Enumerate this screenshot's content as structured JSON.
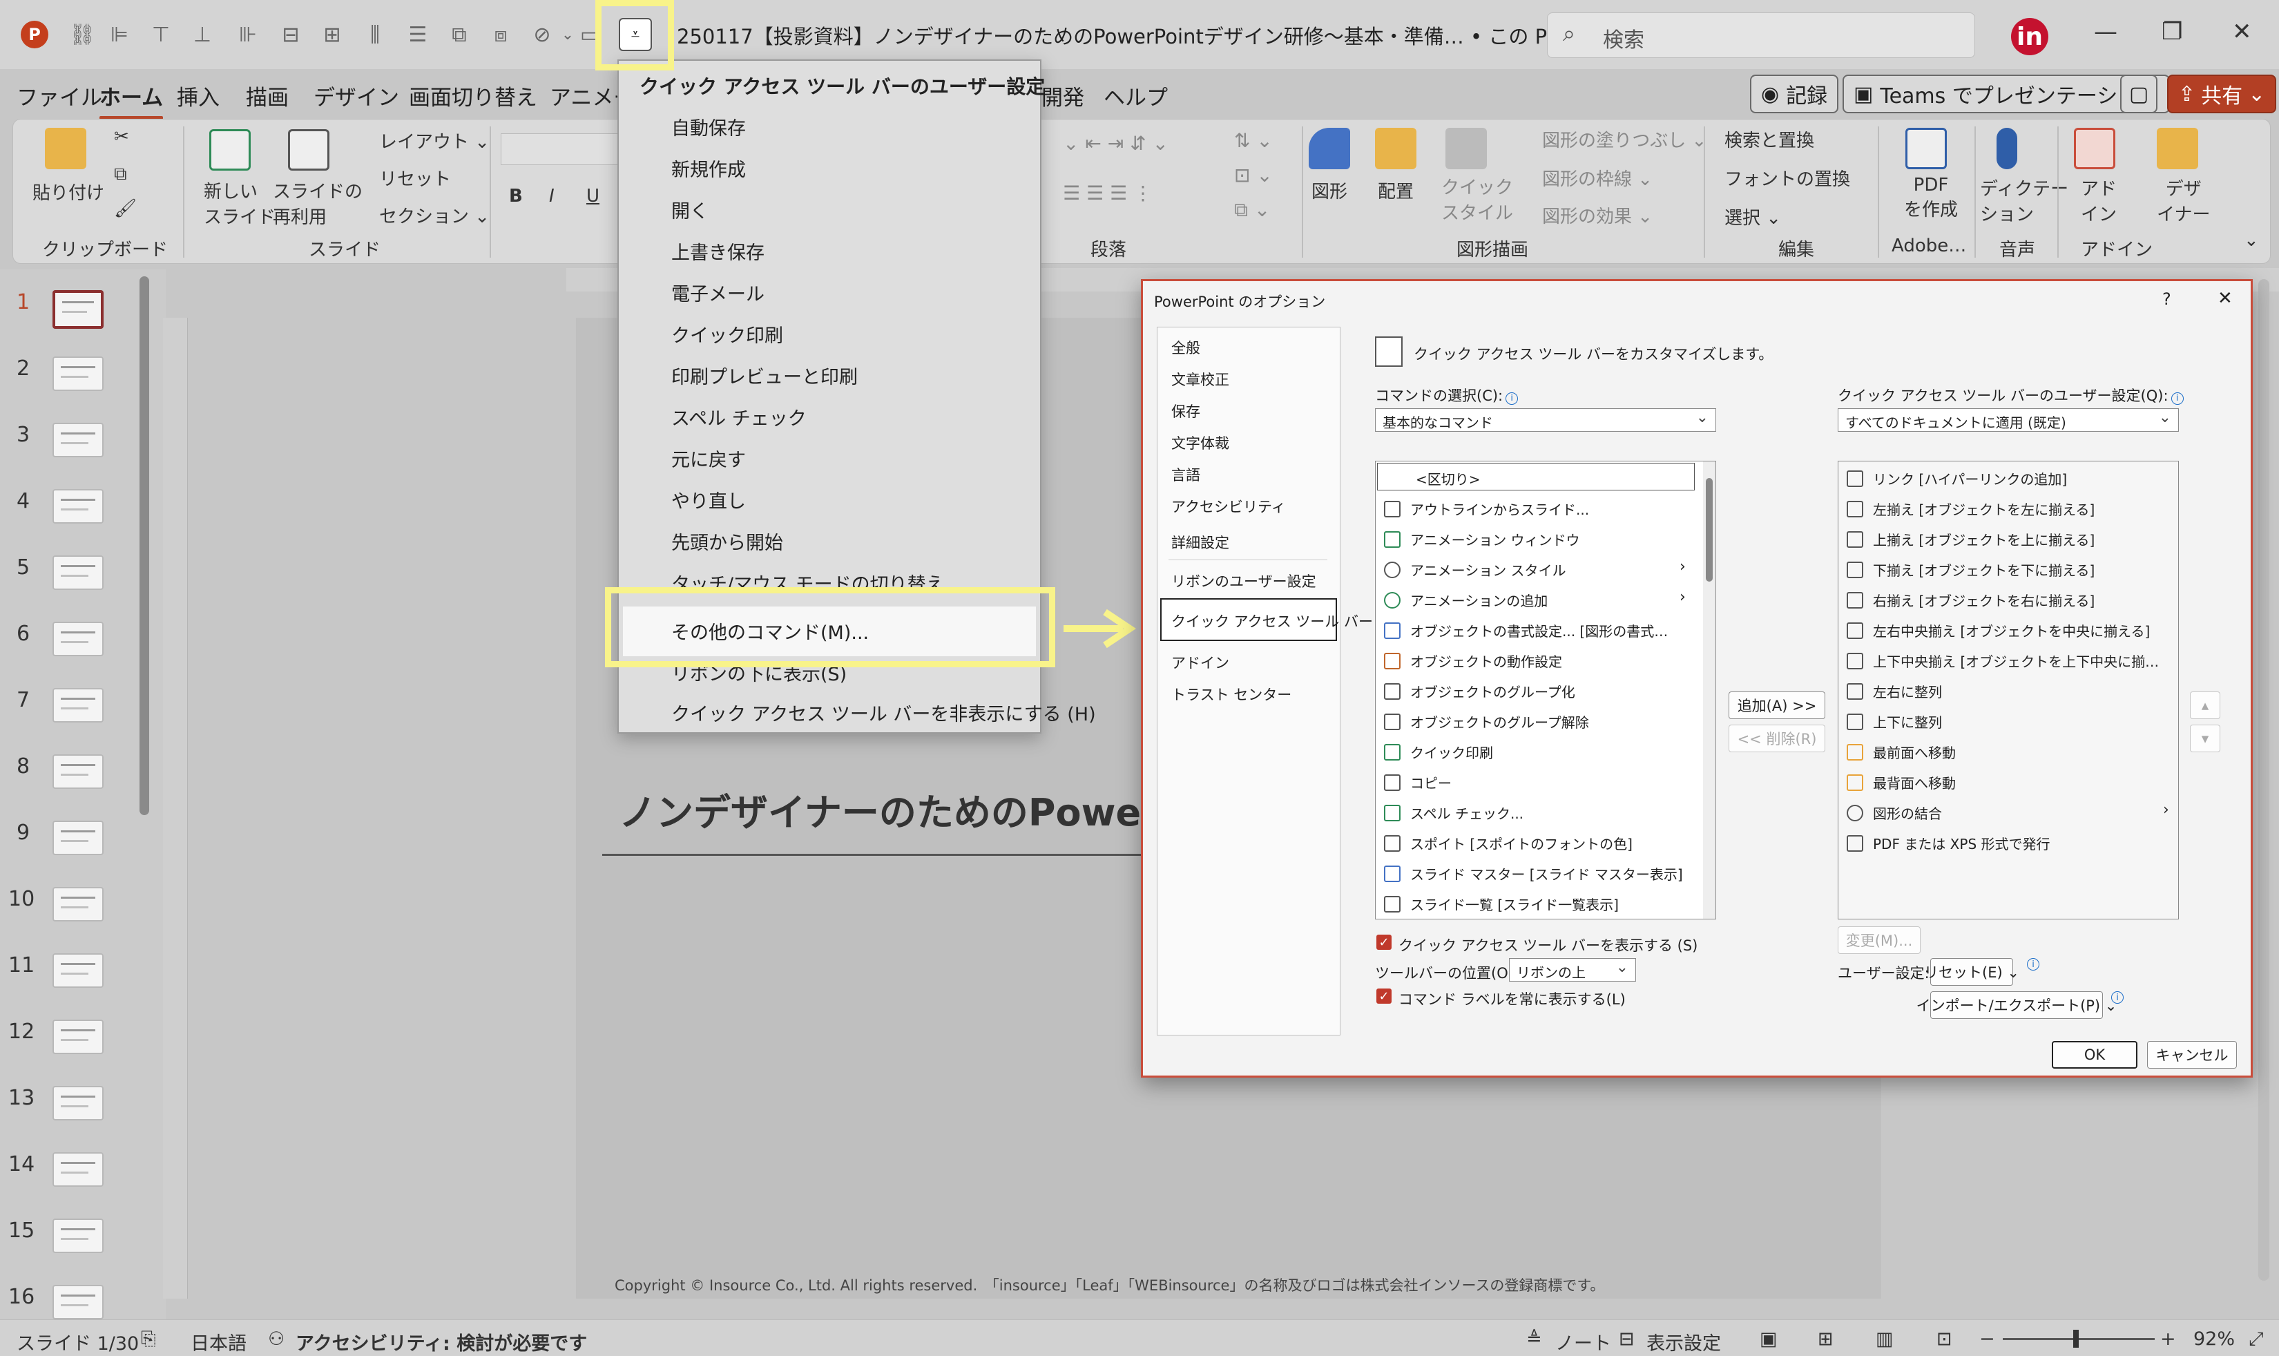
{
  "titlebar": {
    "doc_title": "250117【投影資料】ノンデザイナーのためのPowerPointデザイン研修～基本・準備…  • この PC に保存済み ⌄",
    "search_placeholder": "検索",
    "avatar_initial": "in"
  },
  "tabs": [
    "ファイル",
    "ホーム",
    "挿入",
    "描画",
    "デザイン",
    "画面切り替え",
    "アニメー",
    "開発",
    "ヘルプ"
  ],
  "top_buttons": {
    "record": "記録",
    "teams": "Teams でプレゼンテーション",
    "share": "共有"
  },
  "ribbon": {
    "paste": "貼り付け",
    "new_slide": "新しい\nスライド",
    "reuse_slide": "スライドの\n再利用",
    "layout": "レイアウト ⌄",
    "reset": "リセット",
    "section": "セクション ⌄",
    "shape": "図形",
    "arrange": "配置",
    "quick_style": "クイック\nスタイル",
    "fill": "図形の塗りつぶし ⌄",
    "outline": "図形の枠線 ⌄",
    "effect": "図形の効果 ⌄",
    "find_replace": "検索と置換",
    "font_replace": "フォントの置換",
    "select": "選択 ⌄",
    "pdf": "PDF\nを作成",
    "dictate": "ディクテー\nション",
    "addin": "アド\nイン",
    "designer": "デザ\nイナー",
    "groups": {
      "clipboard": "クリップボード",
      "slides": "スライド",
      "paragraph": "段落",
      "drawing": "図形描画",
      "edit": "編集",
      "adobe": "Adobe…",
      "voice": "音声",
      "addin": "アドイン"
    }
  },
  "slide_numbers": [
    "1",
    "2",
    "3",
    "4",
    "5",
    "6",
    "7",
    "8",
    "9",
    "10",
    "11",
    "12",
    "13",
    "14",
    "15",
    "16"
  ],
  "slide": {
    "title": "ノンデザイナーのためのPowerP",
    "copyright": "Copyright © Insource Co., Ltd. All rights reserved.　「insource」「Leaf」「WEBinsource」の名称及びロゴは株式会社インソースの登録商標です。"
  },
  "statusbar": {
    "slide_count": "スライド 1/30",
    "language": "日本語",
    "accessibility": "アクセシビリティ: 検討が必要です",
    "notes": "ノート",
    "display_settings": "表示設定",
    "zoom": "92%"
  },
  "qat_menu": {
    "header": "クイック アクセス ツール バーのユーザー設定",
    "items": [
      "自動保存",
      "新規作成",
      "開く",
      "上書き保存",
      "電子メール",
      "クイック印刷",
      "印刷プレビューと印刷",
      "スペル チェック",
      "元に戻す",
      "やり直し",
      "先頭から開始",
      "タッチ/マウス モードの切り替え"
    ],
    "more_commands": "その他のコマンド(M)...",
    "show_below": "リボンの下に表示(S)",
    "hide_qat": "クイック アクセス ツール バーを非表示にする (H)"
  },
  "dialog": {
    "title": "PowerPoint のオプション",
    "help": "?",
    "close": "✕",
    "nav": [
      "全般",
      "文章校正",
      "保存",
      "文字体裁",
      "言語",
      "アクセシビリティ",
      "詳細設定",
      "リボンのユーザー設定",
      "クイック アクセス ツール バー",
      "アドイン",
      "トラスト センター"
    ],
    "heading": "クイック アクセス ツール バーをカスタマイズします。",
    "choose_label": "コマンドの選択(C):",
    "choose_value": "基本的なコマンド",
    "custom_label": "クイック アクセス ツール バーのユーザー設定(Q):",
    "custom_value": "すべてのドキュメントに適用 (既定)",
    "left_list": [
      "<区切り>",
      "アウトラインからスライド...",
      "アニメーション ウィンドウ",
      "アニメーション スタイル",
      "アニメーションの追加",
      "オブジェクトの書式設定... [図形の書式…",
      "オブジェクトの動作設定",
      "オブジェクトのグループ化",
      "オブジェクトのグループ解除",
      "クイック印刷",
      "コピー",
      "スペル チェック...",
      "スポイト [スポイトのフォントの色]",
      "スライド マスター [スライド マスター表示]",
      "スライド一覧 [スライド一覧表示]"
    ],
    "right_list": [
      "リンク [ハイパーリンクの追加]",
      "左揃え [オブジェクトを左に揃える]",
      "上揃え [オブジェクトを上に揃える]",
      "下揃え [オブジェクトを下に揃える]",
      "右揃え [オブジェクトを右に揃える]",
      "左右中央揃え [オブジェクトを中央に揃える]",
      "上下中央揃え [オブジェクトを上下中央に揃…",
      "左右に整列",
      "上下に整列",
      "最前面へ移動",
      "最背面へ移動",
      "図形の結合",
      "PDF または XPS 形式で発行"
    ],
    "add": "追加(A) >>",
    "remove": "<< 削除(R)",
    "show_qat": "クイック アクセス ツール バーを表示する (S)",
    "toolbar_pos_label": "ツールバーの位置(O)",
    "toolbar_pos_value": "リボンの上",
    "always_labels": "コマンド ラベルを常に表示する(L)",
    "modify": "変更(M)...",
    "user_settings": "ユーザー設定:",
    "reset": "リセット(E) ⌄",
    "import_export": "インポート/エクスポート(P) ⌄",
    "ok": "OK",
    "cancel": "キャンセル"
  }
}
